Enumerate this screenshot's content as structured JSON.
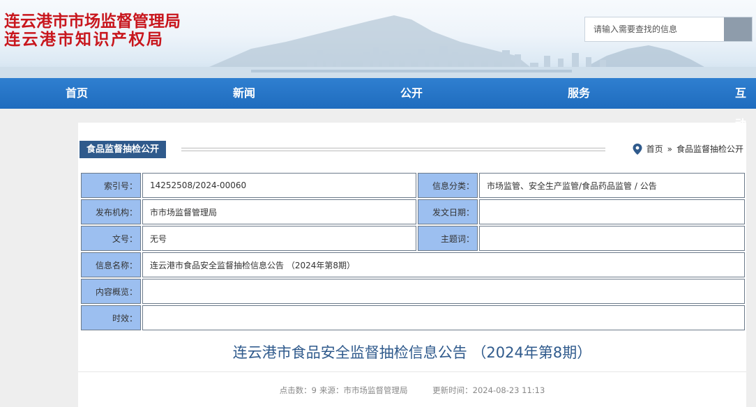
{
  "header": {
    "logo_line1": "连云港市市场监督管理局",
    "logo_line2": "连云港市知识产权局",
    "search_placeholder": "请输入需要查找的信息"
  },
  "nav": {
    "items": [
      "首页",
      "新闻",
      "公开",
      "服务",
      "互动"
    ]
  },
  "section": {
    "title": "食品监督抽检公开",
    "breadcrumb": [
      "首页",
      "»",
      "食品监督抽检公开"
    ]
  },
  "info_table": {
    "index_label": "索引号：",
    "index_value": "14252508/2024-00060",
    "category_label": "信息分类：",
    "category_value": "市场监管、安全生产监管/食品药品监管 / 公告",
    "publisher_label": "发布机构：",
    "publisher_value": "市市场监督管理局",
    "date_label": "发文日期：",
    "date_value": "",
    "docnum_label": "文号：",
    "docnum_value": "无号",
    "subject_label": "主题词：",
    "subject_value": "",
    "name_label": "信息名称：",
    "name_value": "连云港市食品安全监督抽检信息公告 （2024年第8期）",
    "summary_label": "内容概览：",
    "summary_value": "",
    "validity_label": "时效：",
    "validity_value": ""
  },
  "article": {
    "title": "连云港市食品安全监督抽检信息公告 （2024年第8期）",
    "meta_clicks": "点击数：9",
    "meta_source": "来源：市市场监督管理局",
    "meta_updated": "更新时间：2024-08-23 11:13"
  },
  "colors": {
    "logo_red": "#c8161d",
    "nav_blue": "#1f6cbe",
    "section_tab": "#2f5a8c",
    "label_cell": "#9cbff0",
    "title_blue": "#2f5a8c"
  }
}
